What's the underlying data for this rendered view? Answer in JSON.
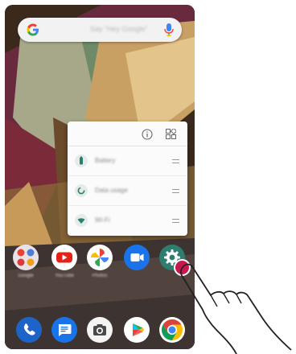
{
  "search": {
    "placeholder": "Say “Hey Google”",
    "logo": "google-g-icon",
    "mic": "mic-icon"
  },
  "popup": {
    "header_icons": [
      "info-icon",
      "widgets-icon"
    ],
    "shortcuts": [
      {
        "label": "Battery",
        "icon": "battery-icon"
      },
      {
        "label": "Data usage",
        "icon": "data-usage-icon"
      },
      {
        "label": "Wi-Fi",
        "icon": "wifi-icon"
      }
    ]
  },
  "apps_row": [
    {
      "label": "Google",
      "icon": "google-folder-icon"
    },
    {
      "label": "YouTube",
      "icon": "youtube-icon"
    },
    {
      "label": "Photos",
      "icon": "photos-icon"
    },
    {
      "label": "Duo",
      "icon": "duo-icon"
    },
    {
      "label": "Settings",
      "icon": "settings-icon"
    }
  ],
  "dock": [
    "phone-icon",
    "messages-icon",
    "camera-icon",
    "play-store-icon",
    "chrome-icon"
  ],
  "colors": {
    "touch": "#c8174e",
    "settings": "#2e7d6e"
  }
}
